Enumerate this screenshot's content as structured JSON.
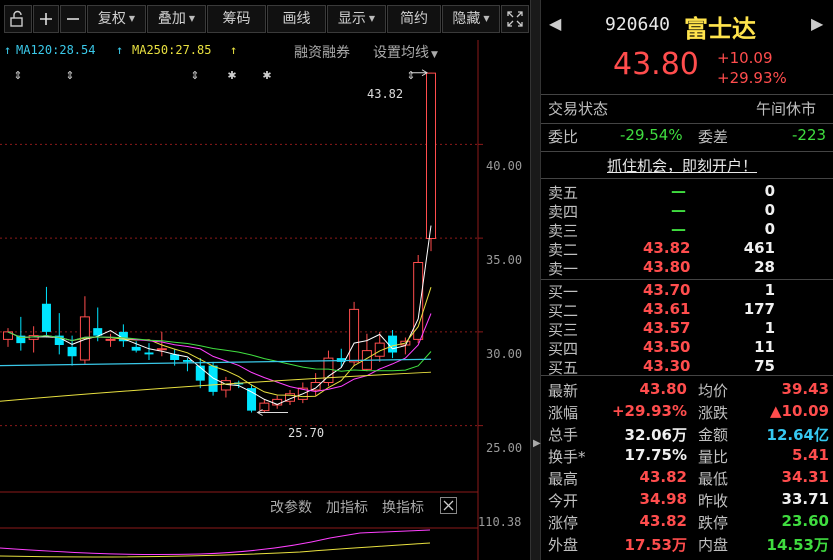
{
  "toolbar": {
    "restore": "复权",
    "overlay": "叠加",
    "chips": "筹码",
    "draw": "画线",
    "display": "显示",
    "simple": "简约",
    "hide": "隐藏"
  },
  "chart": {
    "ma": [
      {
        "label": "MA120:28.54",
        "color": "#3ac8e8"
      },
      {
        "label": "MA250:27.85",
        "color": "#e8e040"
      }
    ],
    "links": {
      "margin": "融资融券",
      "set_ma": "设置均线"
    },
    "y_ticks": [
      "40.00",
      "35.00",
      "30.00",
      "25.00"
    ],
    "annotations": {
      "high": "43.82",
      "low": "25.70"
    },
    "sub": {
      "params": "改参数",
      "add": "加指标",
      "switch": "换指标",
      "value": "110.38"
    }
  },
  "chart_data": {
    "type": "candlestick",
    "ylim": [
      22.5,
      44.5
    ],
    "y_ticks": [
      25,
      30,
      35,
      40
    ],
    "candles": [
      {
        "o": 29.6,
        "h": 30.2,
        "l": 29.2,
        "c": 30.0
      },
      {
        "o": 29.8,
        "h": 30.8,
        "l": 29.0,
        "c": 29.4
      },
      {
        "o": 29.6,
        "h": 30.3,
        "l": 28.9,
        "c": 29.8
      },
      {
        "o": 31.5,
        "h": 32.4,
        "l": 29.7,
        "c": 30.0
      },
      {
        "o": 29.8,
        "h": 31.0,
        "l": 28.8,
        "c": 29.3
      },
      {
        "o": 29.2,
        "h": 29.8,
        "l": 28.2,
        "c": 28.7
      },
      {
        "o": 28.5,
        "h": 31.9,
        "l": 28.3,
        "c": 30.8
      },
      {
        "o": 30.2,
        "h": 31.3,
        "l": 29.5,
        "c": 29.8
      },
      {
        "o": 29.6,
        "h": 29.9,
        "l": 29.2,
        "c": 29.6
      },
      {
        "o": 30.0,
        "h": 30.4,
        "l": 29.2,
        "c": 29.5
      },
      {
        "o": 29.2,
        "h": 29.5,
        "l": 28.9,
        "c": 29.0
      },
      {
        "o": 28.9,
        "h": 29.4,
        "l": 28.5,
        "c": 28.8
      },
      {
        "o": 29.1,
        "h": 30.0,
        "l": 28.7,
        "c": 29.1
      },
      {
        "o": 28.8,
        "h": 29.1,
        "l": 28.2,
        "c": 28.5
      },
      {
        "o": 28.5,
        "h": 28.6,
        "l": 27.9,
        "c": 28.4
      },
      {
        "o": 28.2,
        "h": 28.6,
        "l": 27.0,
        "c": 27.4
      },
      {
        "o": 28.2,
        "h": 28.4,
        "l": 26.6,
        "c": 26.8
      },
      {
        "o": 26.9,
        "h": 27.6,
        "l": 26.5,
        "c": 27.4
      },
      {
        "o": 27.3,
        "h": 27.4,
        "l": 27.0,
        "c": 27.2
      },
      {
        "o": 27.0,
        "h": 27.2,
        "l": 25.7,
        "c": 25.8
      },
      {
        "o": 25.8,
        "h": 26.4,
        "l": 25.7,
        "c": 26.2
      },
      {
        "o": 26.1,
        "h": 26.6,
        "l": 25.9,
        "c": 26.4
      },
      {
        "o": 26.3,
        "h": 26.9,
        "l": 26.1,
        "c": 26.7
      },
      {
        "o": 26.4,
        "h": 27.3,
        "l": 26.2,
        "c": 27.0
      },
      {
        "o": 26.9,
        "h": 27.8,
        "l": 26.6,
        "c": 27.3
      },
      {
        "o": 27.3,
        "h": 29.0,
        "l": 27.1,
        "c": 28.6
      },
      {
        "o": 28.6,
        "h": 29.1,
        "l": 28.1,
        "c": 28.4
      },
      {
        "o": 28.4,
        "h": 31.6,
        "l": 28.2,
        "c": 31.2
      },
      {
        "o": 28.0,
        "h": 29.9,
        "l": 27.9,
        "c": 29.0
      },
      {
        "o": 28.7,
        "h": 30.0,
        "l": 28.4,
        "c": 29.4
      },
      {
        "o": 29.8,
        "h": 30.1,
        "l": 28.6,
        "c": 28.9
      },
      {
        "o": 29.3,
        "h": 29.7,
        "l": 28.8,
        "c": 29.5
      },
      {
        "o": 29.6,
        "h": 34.1,
        "l": 29.4,
        "c": 33.7
      },
      {
        "o": 34.98,
        "h": 43.82,
        "l": 34.31,
        "c": 43.8
      }
    ]
  },
  "quote": {
    "code": "920640",
    "name": "富士达",
    "price": "43.80",
    "change": "+10.09",
    "change_pct": "+29.93%",
    "status_label": "交易状态",
    "status": "午间休市",
    "wb_label": "委比",
    "wb": "-29.54%",
    "wc_label": "委差",
    "wc": "-223",
    "ad": "抓住机会，即刻开户！"
  },
  "order_book": {
    "asks": [
      {
        "label": "卖五",
        "price": "—",
        "vol": "0"
      },
      {
        "label": "卖四",
        "price": "—",
        "vol": "0"
      },
      {
        "label": "卖三",
        "price": "—",
        "vol": "0"
      },
      {
        "label": "卖二",
        "price": "43.82",
        "vol": "461"
      },
      {
        "label": "卖一",
        "price": "43.80",
        "vol": "28"
      }
    ],
    "bids": [
      {
        "label": "买一",
        "price": "43.70",
        "vol": "1"
      },
      {
        "label": "买二",
        "price": "43.61",
        "vol": "177"
      },
      {
        "label": "买三",
        "price": "43.57",
        "vol": "1"
      },
      {
        "label": "买四",
        "price": "43.50",
        "vol": "11"
      },
      {
        "label": "买五",
        "price": "43.30",
        "vol": "75"
      }
    ]
  },
  "stats": [
    {
      "l1": "最新",
      "v1": "43.80",
      "c1": "red",
      "l2": "均价",
      "v2": "39.43",
      "c2": "red"
    },
    {
      "l1": "涨幅",
      "v1": "+29.93%",
      "c1": "red",
      "l2": "涨跌",
      "v2": "▲10.09",
      "c2": "red"
    },
    {
      "l1": "总手",
      "v1": "32.06万",
      "c1": "white",
      "l2": "金额",
      "v2": "12.64亿",
      "c2": "cyan"
    },
    {
      "l1": "换手*",
      "v1": "17.75%",
      "c1": "white",
      "l2": "量比",
      "v2": "5.41",
      "c2": "red"
    },
    {
      "l1": "最高",
      "v1": "43.82",
      "c1": "red",
      "l2": "最低",
      "v2": "34.31",
      "c2": "red"
    },
    {
      "l1": "今开",
      "v1": "34.98",
      "c1": "red",
      "l2": "昨收",
      "v2": "33.71",
      "c2": "white"
    },
    {
      "l1": "涨停",
      "v1": "43.82",
      "c1": "red",
      "l2": "跌停",
      "v2": "23.60",
      "c2": "green"
    },
    {
      "l1": "外盘",
      "v1": "17.53万",
      "c1": "red",
      "l2": "内盘",
      "v2": "14.53万",
      "c2": "green"
    }
  ],
  "colors": {
    "up": "#ff4d4d",
    "down": "#00e5ff",
    "grid": "#8b1a1a"
  }
}
